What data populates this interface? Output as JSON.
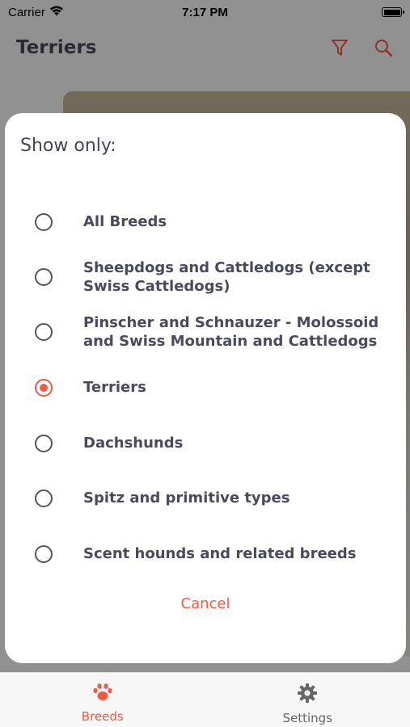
{
  "status_bar": {
    "carrier": "Carrier",
    "time": "7:17 PM"
  },
  "nav": {
    "title": "Terriers",
    "filter_icon": "filter-icon",
    "search_icon": "search-icon"
  },
  "modal": {
    "title": "Show only:",
    "options": [
      {
        "label": "All Breeds",
        "selected": false
      },
      {
        "label": "Sheepdogs and Cattledogs (except Swiss Cattledogs)",
        "selected": false
      },
      {
        "label": "Pinscher and Schnauzer - Molossoid and Swiss Mountain and Cattledogs",
        "selected": false
      },
      {
        "label": "Terriers",
        "selected": true
      },
      {
        "label": "Dachshunds",
        "selected": false
      },
      {
        "label": "Spitz and primitive types",
        "selected": false
      },
      {
        "label": "Scent hounds and related breeds",
        "selected": false
      }
    ],
    "cancel_label": "Cancel"
  },
  "tab_bar": {
    "tabs": [
      {
        "label": "Breeds",
        "icon": "paw-icon",
        "active": true
      },
      {
        "label": "Settings",
        "icon": "gear-icon",
        "active": false
      }
    ]
  },
  "colors": {
    "accent": "#f05a47",
    "text": "#4a4a5e"
  }
}
